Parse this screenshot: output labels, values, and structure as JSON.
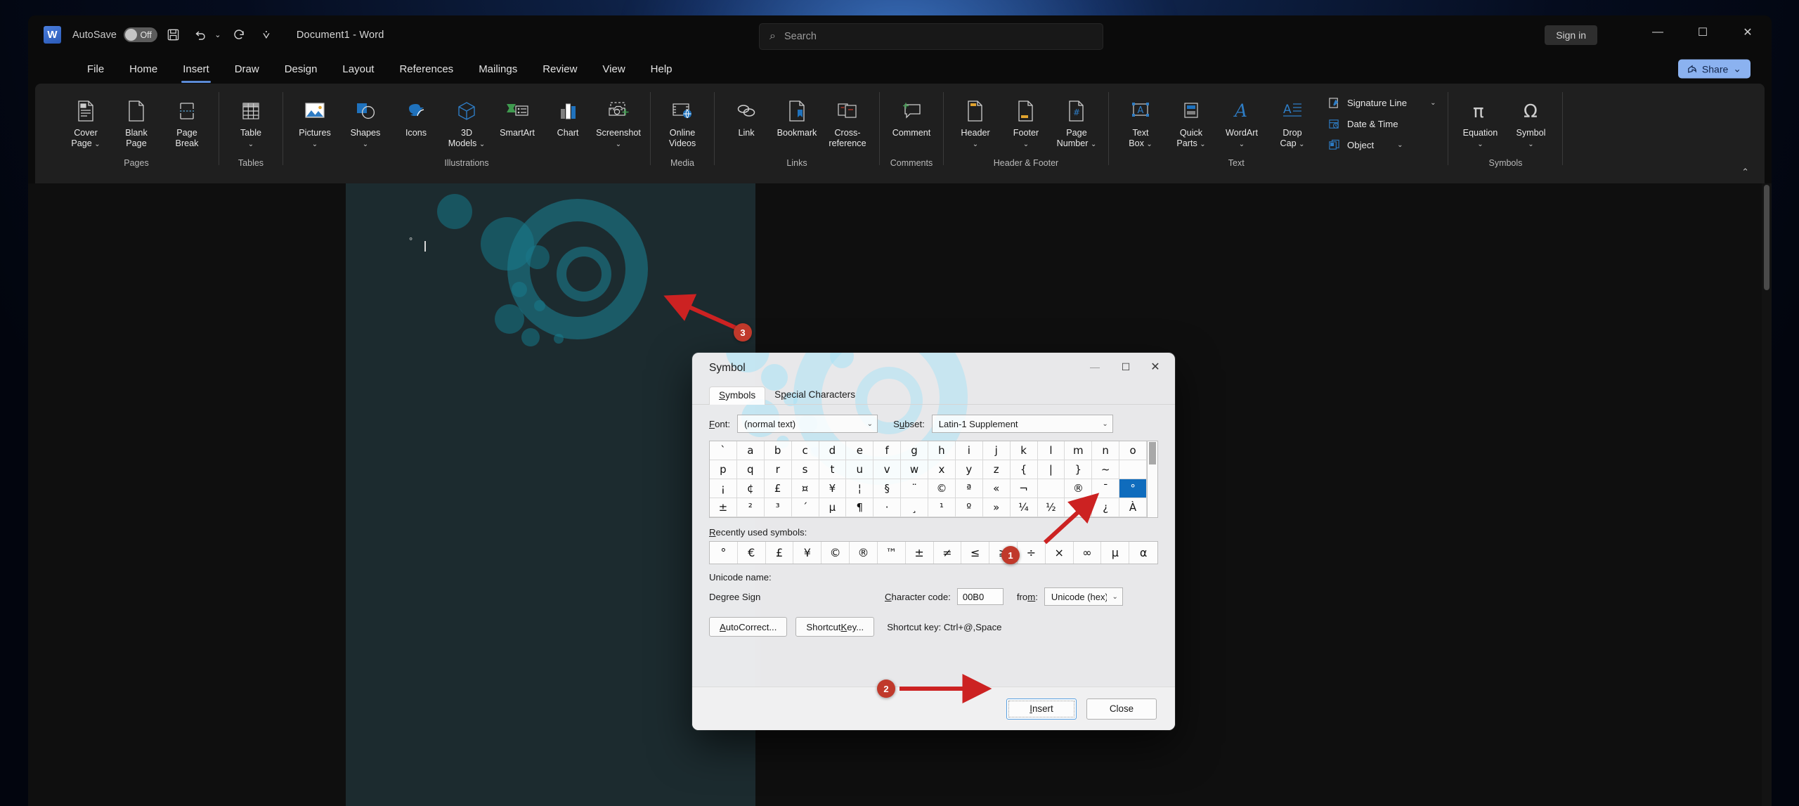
{
  "window": {
    "app_logo": "word-logo",
    "autosave_label": "AutoSave",
    "autosave_state": "Off",
    "document_title": "Document1  -  Word",
    "sign_in": "Sign in",
    "minimize": "—",
    "maximize": "☐",
    "close": "✕"
  },
  "search": {
    "placeholder": "Search",
    "icon": "search-icon"
  },
  "share": {
    "label": "Share",
    "chevron": "⌄"
  },
  "tabs": [
    {
      "label": "File",
      "active": false
    },
    {
      "label": "Home",
      "active": false
    },
    {
      "label": "Insert",
      "active": true
    },
    {
      "label": "Draw",
      "active": false
    },
    {
      "label": "Design",
      "active": false
    },
    {
      "label": "Layout",
      "active": false
    },
    {
      "label": "References",
      "active": false
    },
    {
      "label": "Mailings",
      "active": false
    },
    {
      "label": "Review",
      "active": false
    },
    {
      "label": "View",
      "active": false
    },
    {
      "label": "Help",
      "active": false
    }
  ],
  "quick_access": [
    "save-icon",
    "undo-icon",
    "undo-dropdown-icon",
    "redo-icon",
    "customize-qat-icon"
  ],
  "ribbon": {
    "collapse_chevron": "⌃",
    "groups": [
      {
        "name": "Pages",
        "label": "Pages",
        "buttons": [
          {
            "label": "Cover\nPage",
            "icon": "cover-page-icon",
            "dropdown": true
          },
          {
            "label": "Blank\nPage",
            "icon": "blank-page-icon",
            "dropdown": false
          },
          {
            "label": "Page\nBreak",
            "icon": "page-break-icon",
            "dropdown": false
          }
        ]
      },
      {
        "name": "Tables",
        "label": "Tables",
        "buttons": [
          {
            "label": "Table",
            "icon": "table-icon",
            "dropdown": true
          }
        ]
      },
      {
        "name": "Illustrations",
        "label": "Illustrations",
        "buttons": [
          {
            "label": "Pictures",
            "icon": "pictures-icon",
            "dropdown": true
          },
          {
            "label": "Shapes",
            "icon": "shapes-icon",
            "dropdown": true
          },
          {
            "label": "Icons",
            "icon": "icons-icon",
            "dropdown": false
          },
          {
            "label": "3D\nModels",
            "icon": "3d-models-icon",
            "dropdown": true
          },
          {
            "label": "SmartArt",
            "icon": "smartart-icon",
            "dropdown": false
          },
          {
            "label": "Chart",
            "icon": "chart-icon",
            "dropdown": false
          },
          {
            "label": "Screenshot",
            "icon": "screenshot-icon",
            "dropdown": true
          }
        ]
      },
      {
        "name": "Media",
        "label": "Media",
        "buttons": [
          {
            "label": "Online\nVideos",
            "icon": "online-videos-icon",
            "dropdown": false
          }
        ]
      },
      {
        "name": "Links",
        "label": "Links",
        "buttons": [
          {
            "label": "Link",
            "icon": "link-icon",
            "dropdown": false
          },
          {
            "label": "Bookmark",
            "icon": "bookmark-icon",
            "dropdown": false
          },
          {
            "label": "Cross-\nreference",
            "icon": "cross-reference-icon",
            "dropdown": false
          }
        ]
      },
      {
        "name": "Comments",
        "label": "Comments",
        "buttons": [
          {
            "label": "Comment",
            "icon": "comment-icon",
            "dropdown": false
          }
        ]
      },
      {
        "name": "Header & Footer",
        "label": "Header & Footer",
        "buttons": [
          {
            "label": "Header",
            "icon": "header-icon",
            "dropdown": true
          },
          {
            "label": "Footer",
            "icon": "footer-icon",
            "dropdown": true
          },
          {
            "label": "Page\nNumber",
            "icon": "page-number-icon",
            "dropdown": true
          }
        ]
      },
      {
        "name": "Text",
        "label": "Text",
        "buttons": [
          {
            "label": "Text\nBox",
            "icon": "text-box-icon",
            "dropdown": true
          },
          {
            "label": "Quick\nParts",
            "icon": "quick-parts-icon",
            "dropdown": true
          },
          {
            "label": "WordArt",
            "icon": "wordart-icon",
            "dropdown": true
          },
          {
            "label": "Drop\nCap",
            "icon": "drop-cap-icon",
            "dropdown": true
          }
        ],
        "small_buttons": [
          {
            "label": "Signature Line",
            "icon": "signature-line-icon",
            "dropdown": true
          },
          {
            "label": "Date & Time",
            "icon": "date-time-icon",
            "dropdown": false
          },
          {
            "label": "Object",
            "icon": "object-icon",
            "dropdown": true
          }
        ]
      },
      {
        "name": "Symbols",
        "label": "Symbols",
        "buttons": [
          {
            "label": "Equation",
            "icon": "equation-icon",
            "dropdown": true
          },
          {
            "label": "Symbol",
            "icon": "symbol-icon",
            "dropdown": true
          }
        ]
      }
    ]
  },
  "document": {
    "inserted_character": "°"
  },
  "dialog": {
    "title": "Symbol",
    "minimize": "—",
    "maximize": "☐",
    "close": "✕",
    "tabs": [
      {
        "label": "Symbols",
        "active": true
      },
      {
        "label": "Special Characters",
        "active": false
      }
    ],
    "font": {
      "label": "Font:",
      "value": "(normal text)",
      "chevron": "⌄"
    },
    "subset": {
      "label": "Subset:",
      "value": "Latin-1 Supplement",
      "chevron": "⌄"
    },
    "grid_cells": [
      "`",
      "a",
      "b",
      "c",
      "d",
      "e",
      "f",
      "g",
      "h",
      "i",
      "j",
      "k",
      "l",
      "m",
      "n",
      "o",
      "p",
      "q",
      "r",
      "s",
      "t",
      "u",
      "v",
      "w",
      "x",
      "y",
      "z",
      "{",
      "|",
      "}",
      "~",
      "",
      "¡",
      "¢",
      "£",
      "¤",
      "¥",
      "¦",
      "§",
      "¨",
      "©",
      "ª",
      "«",
      "¬",
      "­",
      "®",
      "¯",
      "°",
      "±",
      "²",
      "³",
      "´",
      "µ",
      "¶",
      "·",
      "¸",
      "¹",
      "º",
      "»",
      "¼",
      "½",
      "¾",
      "¿",
      "À"
    ],
    "selected_cell_index": 47,
    "recently_used_label": "Recently used symbols:",
    "recent_symbols": [
      "°",
      "€",
      "£",
      "¥",
      "©",
      "®",
      "™",
      "±",
      "≠",
      "≤",
      "≥",
      "÷",
      "×",
      "∞",
      "µ",
      "α"
    ],
    "unicode_name_label": "Unicode name:",
    "unicode_name_value": "Degree Sign",
    "character_code_label": "Character code:",
    "character_code_value": "00B0",
    "from_label": "from:",
    "from_value": "Unicode (hex)",
    "from_chevron": "⌄",
    "autocorrect_button": "AutoCorrect...",
    "shortcut_key_button": "Shortcut Key...",
    "shortcut_key_text": "Shortcut key: Ctrl+@,Space",
    "insert_button": "Insert",
    "close_button": "Close"
  },
  "annotations": [
    {
      "id": "1",
      "label": "1"
    },
    {
      "id": "2",
      "label": "2"
    },
    {
      "id": "3",
      "label": "3"
    }
  ],
  "colors": {
    "accent": "#0f6cbd",
    "annotation": "#c0392b",
    "share": "#8bb2f0",
    "tab_underline": "#5b8ad6"
  }
}
